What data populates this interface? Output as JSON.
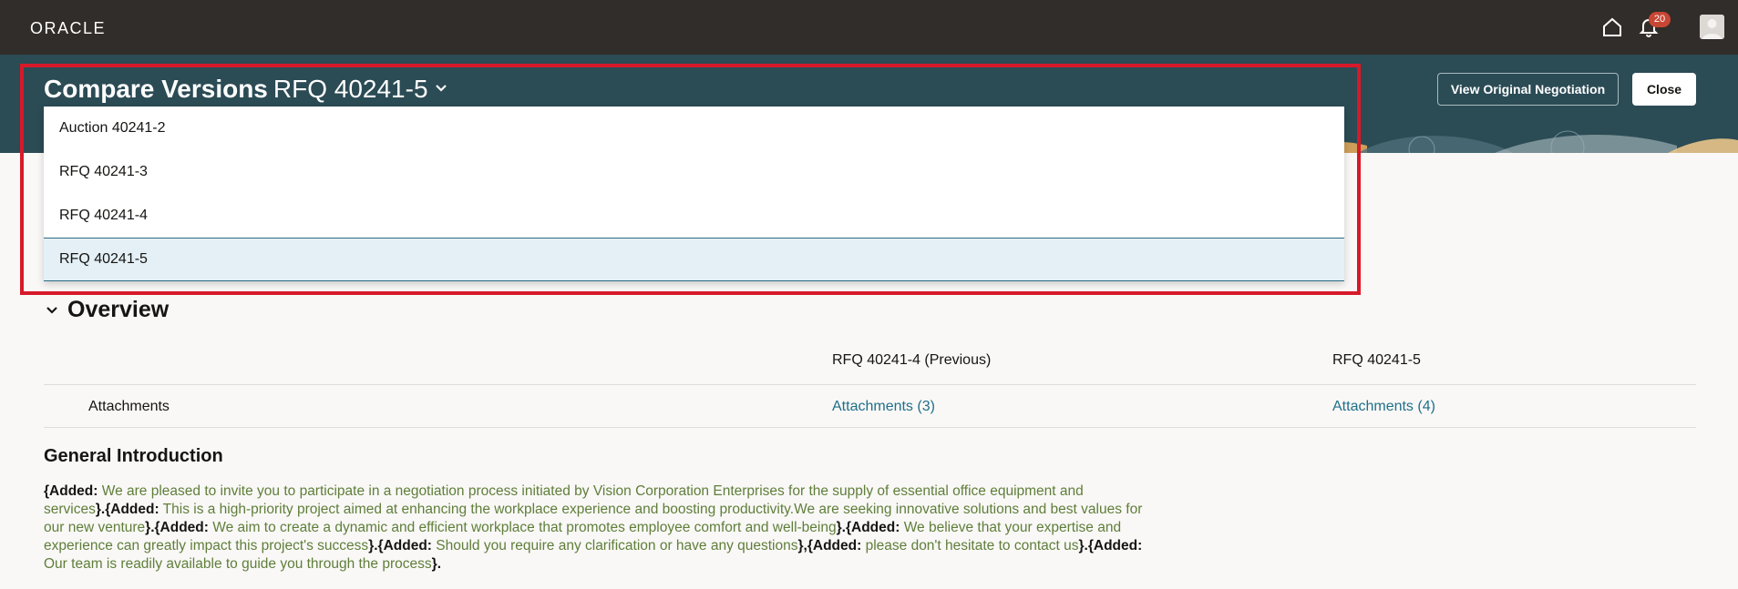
{
  "app": {
    "logo": "ORACLE",
    "notification_count": "20"
  },
  "header": {
    "title_bold": "Compare Versions",
    "title_version": "RFQ 40241-5",
    "view_original_label": "View Original Negotiation",
    "close_label": "Close"
  },
  "dropdown": {
    "options": [
      "Auction 40241-2",
      "RFQ 40241-3",
      "RFQ 40241-4",
      "RFQ 40241-5"
    ],
    "selected": "RFQ 40241-5"
  },
  "overview": {
    "title": "Overview",
    "col_previous": "RFQ 40241-4 (Previous)",
    "col_current": "RFQ 40241-5",
    "rows": [
      {
        "label": "Attachments",
        "previous": "Attachments (3)",
        "current": "Attachments (4)"
      }
    ]
  },
  "general_intro": {
    "title": "General Introduction",
    "added_tag": "{Added:",
    "close_tag": "}",
    "segments": [
      {
        "text": " We are pleased to invite you to participate in a negotiation process initiated by Vision Corporation Enterprises for the supply of essential office equipment and services",
        "sep": "."
      },
      {
        "text": " This is a high-priority project aimed at enhancing the workplace experience and boosting productivity.We are seeking innovative solutions and best values for our new venture",
        "sep": "."
      },
      {
        "text": " We aim to create a dynamic and efficient workplace that promotes employee comfort and well-being",
        "sep": "."
      },
      {
        "text": " We believe that your expertise and experience can greatly impact this project's success",
        "sep": "."
      },
      {
        "text": " Should you require any clarification or have any questions",
        "sep": ","
      },
      {
        "text": " please don't hesitate to contact us",
        "sep": "."
      },
      {
        "text": " Our team is readily available to guide you through the process",
        "sep": "."
      }
    ]
  },
  "colors": {
    "topbar": "#312d2a",
    "header_band": "#2b4b55",
    "highlight": "#d7192a",
    "link": "#1f6f8b",
    "added_text": "#5f7e3a",
    "badge": "#c74634"
  }
}
